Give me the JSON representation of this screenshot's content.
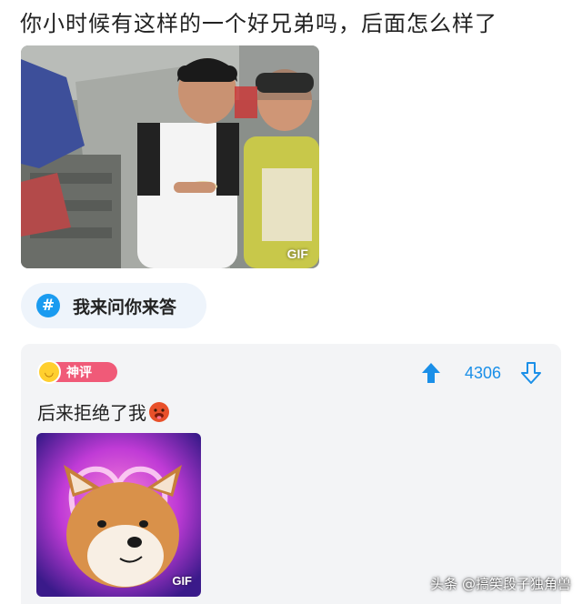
{
  "post": {
    "title": "你小时候有这样的一个好兄弟吗，后面怎么样了",
    "gif_label": "GIF"
  },
  "topic": {
    "icon": "#",
    "label": "我来问你来答"
  },
  "comment": {
    "badge_label": "神评",
    "vote_count": "4306",
    "text": "后来拒绝了我",
    "gif_label": "GIF"
  },
  "watermark": "头条 @搞笑段子独角兽",
  "colors": {
    "accent_blue": "#1a9bf0",
    "badge_pink": "#f05a78",
    "card_bg": "#f3f4f6",
    "chip_bg": "#eef4fb"
  },
  "icons": {
    "upvote": "arrow-up-icon",
    "downvote": "arrow-down-icon",
    "badge": "smiley-face-icon"
  }
}
